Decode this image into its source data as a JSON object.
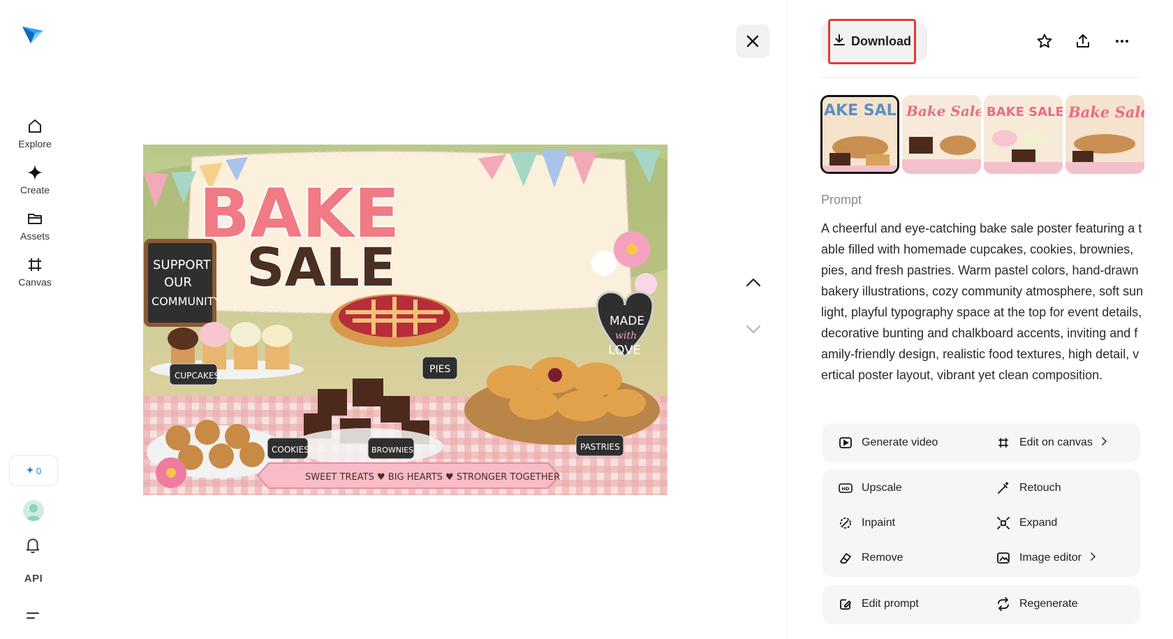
{
  "sidebar": {
    "nav": [
      {
        "label": "Explore",
        "icon": "home-icon"
      },
      {
        "label": "Create",
        "icon": "sparkle-icon"
      },
      {
        "label": "Assets",
        "icon": "folder-icon"
      },
      {
        "label": "Canvas",
        "icon": "canvas-icon"
      }
    ],
    "credits": "0",
    "api_label": "API"
  },
  "poster": {
    "title_line1": "BAKE",
    "title_line2": "SALE",
    "chalk_left": [
      "SUPPORT",
      "OUR",
      "COMMUNITY"
    ],
    "chalk_right": [
      "MADE",
      "with",
      "LOVE"
    ],
    "labels": [
      "CUPCAKES",
      "PIES",
      "COOKIES",
      "BROWNIES",
      "PASTRIES"
    ],
    "banner": "SWEET TREATS ♥ BIG HEARTS ♥ STRONGER TOGETHER"
  },
  "toolbar": {
    "download_label": "Download"
  },
  "thumbnails": [
    {
      "text": "AKE SALE",
      "selected": true
    },
    {
      "text": "Bake Sale!"
    },
    {
      "text": "BAKE SALE!"
    },
    {
      "text": "Bake Sale!"
    }
  ],
  "prompt": {
    "label": "Prompt",
    "text": "A cheerful and eye-catching bake sale poster featuring a table filled with homemade cupcakes, cookies, brownies, pies, and fresh pastries. Warm pastel colors, hand-drawn bakery illustrations, cozy community atmosphere, soft sunlight, playful typography space at the top for event details, decorative bunting and chalkboard accents, inviting and family-friendly design, realistic food textures, high detail, vertical poster layout, vibrant yet clean composition."
  },
  "actions": {
    "generate_video": "Generate video",
    "edit_on_canvas": "Edit on canvas",
    "upscale": "Upscale",
    "retouch": "Retouch",
    "inpaint": "Inpaint",
    "expand": "Expand",
    "remove": "Remove",
    "image_editor": "Image editor",
    "edit_prompt": "Edit prompt",
    "regenerate": "Regenerate"
  }
}
